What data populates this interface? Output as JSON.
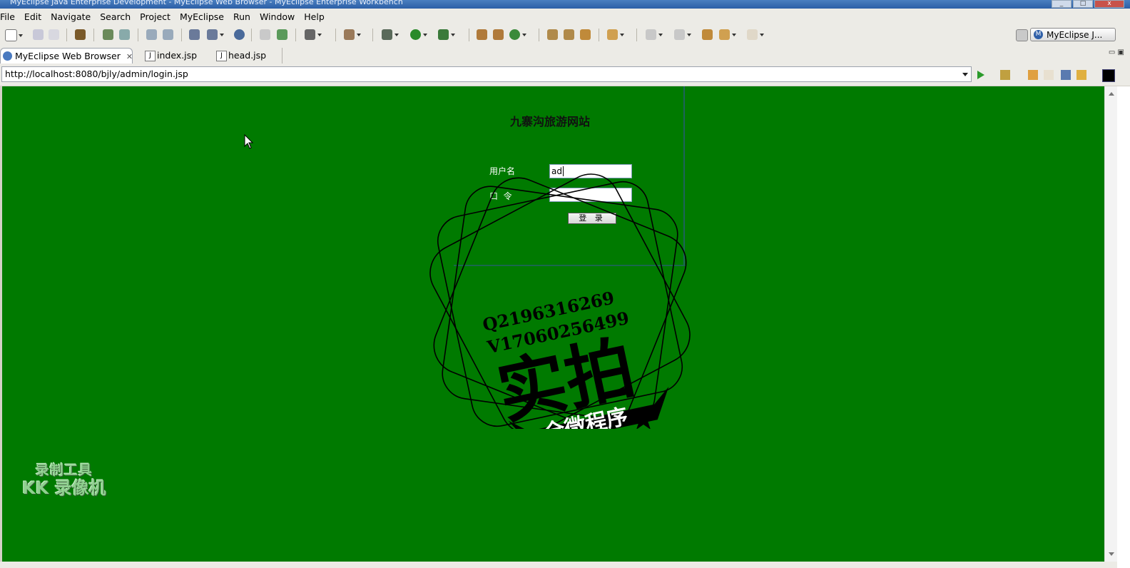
{
  "window": {
    "title": "MyEclipse Java Enterprise Development - MyEclipse Web Browser - MyEclipse Enterprise Workbench"
  },
  "menu": [
    "File",
    "Edit",
    "Navigate",
    "Search",
    "Project",
    "MyEclipse",
    "Run",
    "Window",
    "Help"
  ],
  "perspective": {
    "label": "MyEclipse J..."
  },
  "tabs": [
    {
      "label": "MyEclipse Web Browser",
      "active": true
    },
    {
      "label": "index.jsp"
    },
    {
      "label": "head.jsp"
    }
  ],
  "address": {
    "url": "http://localhost:8080/bjly/admin/login.jsp"
  },
  "page": {
    "background": "#007a00",
    "site_title": "九寨沟旅游网站",
    "username_label": "用户名",
    "username_value": "ad",
    "password_label": "口  令",
    "password_value": "",
    "login_button": "登 录"
  },
  "stamp": {
    "line1": "Q2196316269",
    "line2": "V17060256499",
    "big": "实拍",
    "banner": "全微程序"
  },
  "recorder_watermark": {
    "line1": "录制工具",
    "line2": "KK 录像机"
  }
}
